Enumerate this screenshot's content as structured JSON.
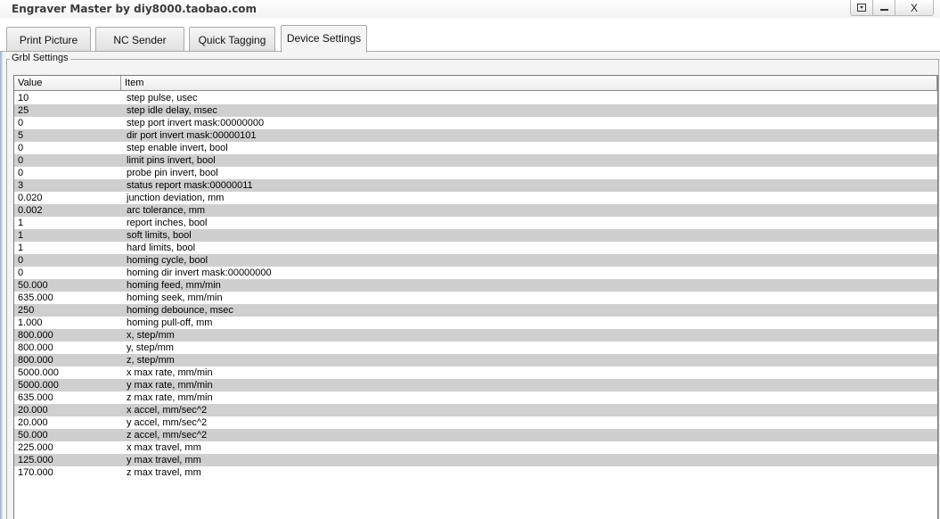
{
  "window": {
    "title": "Engraver Master by diy8000.taobao.com",
    "buttons": {
      "dropdown_icon": "dropdown-menu-icon",
      "minimize_icon": "minimize-icon",
      "close_label": "X"
    }
  },
  "tabs": [
    {
      "label": "Print Picture",
      "active": false
    },
    {
      "label": "NC Sender",
      "active": false
    },
    {
      "label": "Quick Tagging",
      "active": false
    },
    {
      "label": "Device Settings",
      "active": true
    }
  ],
  "group": {
    "label": "Grbl Settings"
  },
  "table": {
    "columns": [
      "Value",
      "Item"
    ],
    "rows": [
      {
        "value": "10",
        "item": "step pulse, usec"
      },
      {
        "value": "25",
        "item": "step idle delay, msec"
      },
      {
        "value": "0",
        "item": "step port invert mask:00000000"
      },
      {
        "value": "5",
        "item": "dir port invert mask:00000101"
      },
      {
        "value": "0",
        "item": "step enable invert, bool"
      },
      {
        "value": "0",
        "item": "limit pins invert, bool"
      },
      {
        "value": "0",
        "item": "probe pin invert, bool"
      },
      {
        "value": "3",
        "item": "status report mask:00000011"
      },
      {
        "value": "0.020",
        "item": "junction deviation, mm"
      },
      {
        "value": "0.002",
        "item": "arc tolerance, mm"
      },
      {
        "value": "1",
        "item": "report inches, bool"
      },
      {
        "value": "1",
        "item": "soft limits, bool"
      },
      {
        "value": "1",
        "item": "hard limits, bool"
      },
      {
        "value": "0",
        "item": "homing cycle, bool"
      },
      {
        "value": "0",
        "item": "homing dir invert mask:00000000"
      },
      {
        "value": "50.000",
        "item": "homing feed, mm/min"
      },
      {
        "value": "635.000",
        "item": "homing seek, mm/min"
      },
      {
        "value": "250",
        "item": "homing debounce, msec"
      },
      {
        "value": "1.000",
        "item": "homing pull-off, mm"
      },
      {
        "value": "800.000",
        "item": "x, step/mm"
      },
      {
        "value": "800.000",
        "item": "y, step/mm"
      },
      {
        "value": "800.000",
        "item": "z, step/mm"
      },
      {
        "value": "5000.000",
        "item": "x max rate, mm/min"
      },
      {
        "value": "5000.000",
        "item": "y max rate, mm/min"
      },
      {
        "value": "635.000",
        "item": "z max rate, mm/min"
      },
      {
        "value": "20.000",
        "item": "x accel, mm/sec^2"
      },
      {
        "value": "20.000",
        "item": "y accel, mm/sec^2"
      },
      {
        "value": "50.000",
        "item": "z accel, mm/sec^2"
      },
      {
        "value": "225.000",
        "item": "x max travel, mm"
      },
      {
        "value": "125.000",
        "item": "y max travel, mm"
      },
      {
        "value": "170.000",
        "item": "z max travel, mm"
      }
    ]
  },
  "colors": {
    "row_alt": "#cfcfcf",
    "panel_bg": "#f4f4f4"
  }
}
